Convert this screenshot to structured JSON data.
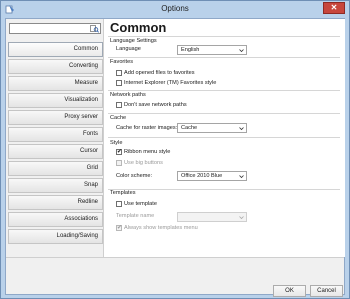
{
  "window": {
    "title": "Options",
    "close_glyph": "✕",
    "app_icon": "options-app-icon"
  },
  "search": {
    "value": "",
    "placeholder": ""
  },
  "nav": {
    "items": [
      "Common",
      "Converting",
      "Measure",
      "Visualization",
      "Proxy server",
      "Fonts",
      "Cursor",
      "Grid",
      "Snap",
      "Redline",
      "Associations",
      "Loading/Saving"
    ],
    "active": "Common"
  },
  "page": {
    "heading": "Common",
    "language_settings": {
      "section": "Language Settings",
      "label": "Language",
      "value": "English"
    },
    "favorites": {
      "section": "Favorites",
      "add_opened": "Add opened files to favorites",
      "ie_style": "Internet Explorer (TM) Favorites style"
    },
    "network_paths": {
      "section": "Network paths",
      "dont_save": "Don't save network paths"
    },
    "cache": {
      "section": "Cache",
      "label": "Cache for raster images:",
      "value": "Cache"
    },
    "style": {
      "section": "Style",
      "ribbon": "Ribbon menu style",
      "big_buttons": "Use big buttons",
      "scheme_label": "Color scheme:",
      "scheme_value": "Office 2010 Blue"
    },
    "templates": {
      "section": "Templates",
      "use_template": "Use template",
      "name_label": "Template name",
      "name_value": "",
      "always_show": "Always show templates menu"
    }
  },
  "buttons": {
    "ok": "OK",
    "cancel": "Cancel"
  },
  "colors": {
    "frame": "#b9d1ea",
    "close": "#c7463c"
  }
}
